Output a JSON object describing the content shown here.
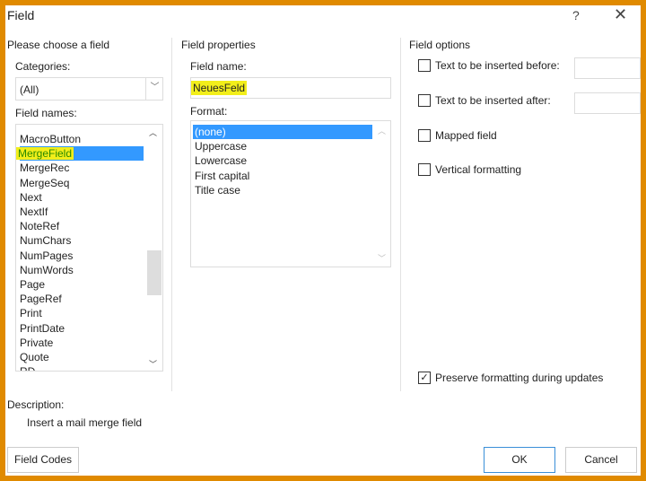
{
  "window": {
    "title": "Field",
    "help": "?",
    "close": "✕"
  },
  "left": {
    "heading": "Please choose a field",
    "categories_label": "Categories:",
    "categories_value": "(All)",
    "field_names_label": "Field names:",
    "field_names": [
      "MacroButton",
      "MergeField",
      "MergeRec",
      "MergeSeq",
      "Next",
      "NextIf",
      "NoteRef",
      "NumChars",
      "NumPages",
      "NumWords",
      "Page",
      "PageRef",
      "Print",
      "PrintDate",
      "Private",
      "Quote",
      "RD"
    ],
    "selected": "MergeField"
  },
  "middle": {
    "heading": "Field properties",
    "field_name_label": "Field name:",
    "field_name_value": "NeuesFeld",
    "format_label": "Format:",
    "formats": [
      "(none)",
      "Uppercase",
      "Lowercase",
      "First capital",
      "Title case"
    ],
    "selected": "(none)"
  },
  "right": {
    "heading": "Field options",
    "options": [
      {
        "label": "Text to be inserted before:",
        "checked": false
      },
      {
        "label": "Text to be inserted after:",
        "checked": false
      },
      {
        "label": "Mapped field",
        "checked": false
      },
      {
        "label": "Vertical formatting",
        "checked": false
      }
    ],
    "preserve": {
      "label": "Preserve formatting during updates",
      "checked": true
    }
  },
  "description": {
    "label": "Description:",
    "text": "Insert a mail merge field"
  },
  "buttons": {
    "field_codes": "Field Codes",
    "ok": "OK",
    "cancel": "Cancel"
  },
  "colors": {
    "frame": "#e08a00",
    "selection": "#3399ff",
    "highlight": "#f2ee1a"
  }
}
